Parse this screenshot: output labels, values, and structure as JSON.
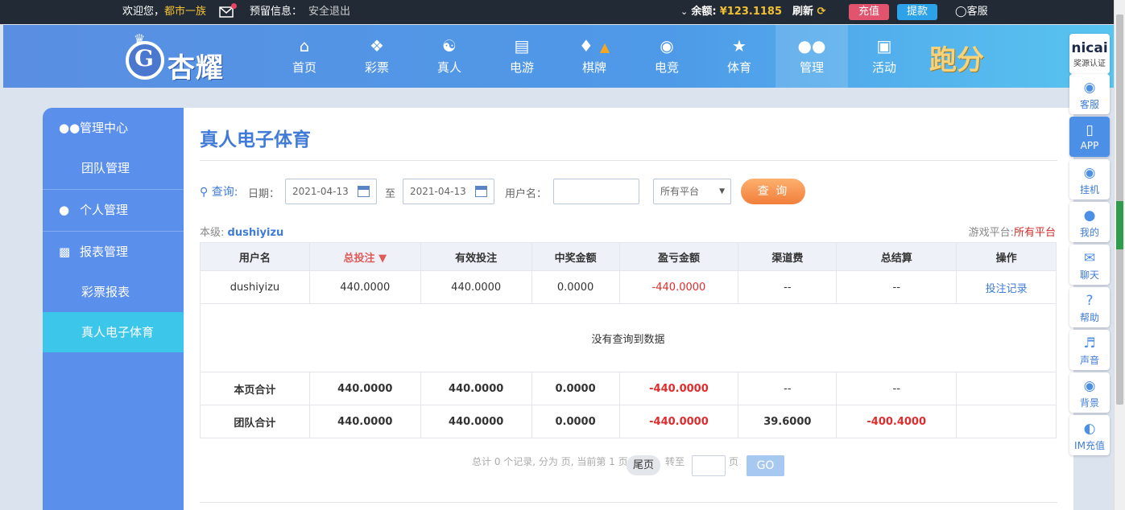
{
  "topbar": {
    "welcome": "欢迎您，",
    "username": "都市一族",
    "reserved_info": "预留信息：",
    "logout": "安全退出",
    "balance_label": "余额:",
    "balance_value": "¥123.1185",
    "refresh": "刷新",
    "recharge": "充值",
    "withdraw": "提款",
    "service": "客服"
  },
  "header": {
    "logo_text": "杏耀",
    "logo_letter": "G",
    "promo_text": "跑分",
    "nav": [
      {
        "label": "首页",
        "icon": "home-icon"
      },
      {
        "label": "彩票",
        "icon": "ticket-icon"
      },
      {
        "label": "真人",
        "icon": "person-icon"
      },
      {
        "label": "电游",
        "icon": "slot-machine-icon"
      },
      {
        "label": "棋牌",
        "icon": "cards-icon"
      },
      {
        "label": "电竞",
        "icon": "gamepad-icon"
      },
      {
        "label": "体育",
        "icon": "trophy-icon"
      },
      {
        "label": "管理",
        "icon": "users-icon"
      },
      {
        "label": "活动",
        "icon": "gift-icon"
      }
    ]
  },
  "sidebar": {
    "sections": [
      {
        "title": "管理中心",
        "icon": "users-icon",
        "items": [
          "团队管理"
        ]
      },
      {
        "title": "个人管理",
        "icon": "user-icon",
        "items": []
      },
      {
        "title": "报表管理",
        "icon": "document-icon",
        "items": [
          "彩票报表",
          "真人电子体育"
        ]
      }
    ],
    "active_item": "真人电子体育"
  },
  "main": {
    "title": "真人电子体育",
    "query": {
      "label": "查询:",
      "date_label": "日期：",
      "date_from": "2021-04-13",
      "to_label": "至",
      "date_to": "2021-04-13",
      "username_label": "用户名：",
      "username_value": "",
      "platform_select": "所有平台",
      "button": "查 询"
    },
    "level_label": "本级:",
    "level_user": "dushiyizu",
    "platform_label": "游戏平台:",
    "platform_value": "所有平台",
    "table": {
      "headers": [
        "用户名",
        "总投注",
        "有效投注",
        "中奖金额",
        "盈亏金额",
        "渠道费",
        "总结算",
        "操作"
      ],
      "rows": [
        [
          "dushiyizu",
          "440.0000",
          "440.0000",
          "0.0000",
          "-440.0000",
          "--",
          "--",
          "投注记录"
        ]
      ],
      "empty_text": "没有查询到数据",
      "page_total": [
        "本页合计",
        "440.0000",
        "440.0000",
        "0.0000",
        "-440.0000",
        "--",
        "--",
        ""
      ],
      "team_total": [
        "团队合计",
        "440.0000",
        "440.0000",
        "0.0000",
        "-440.0000",
        "39.6000",
        "-400.4000",
        ""
      ]
    },
    "pager": {
      "summary": "总计 0 个记录, 分为 页, 当前第 1 页",
      "last": "尾页",
      "goto": "转至",
      "page_unit": "页",
      "go": "GO"
    }
  },
  "rightbar": {
    "logo": "nicai",
    "logo_sub": "奖源认证",
    "items": [
      {
        "label": "客服",
        "icon": "headset-icon"
      },
      {
        "label": "APP",
        "icon": "phone-icon"
      },
      {
        "label": "挂机",
        "icon": "moneybag-icon"
      },
      {
        "label": "我的",
        "icon": "user-icon"
      },
      {
        "label": "聊天",
        "icon": "chat-icon"
      },
      {
        "label": "帮助",
        "icon": "help-icon"
      },
      {
        "label": "声音",
        "icon": "speaker-icon"
      },
      {
        "label": "背景",
        "icon": "palette-icon"
      },
      {
        "label": "IM充值",
        "icon": "im-icon"
      }
    ]
  },
  "colors": {
    "accent_blue": "#3f7bd7",
    "sidebar_blue": "#5b8fec",
    "active_cyan": "#3cc7ea",
    "negative_red": "#e02c2c",
    "query_orange": "#f27e3b"
  }
}
